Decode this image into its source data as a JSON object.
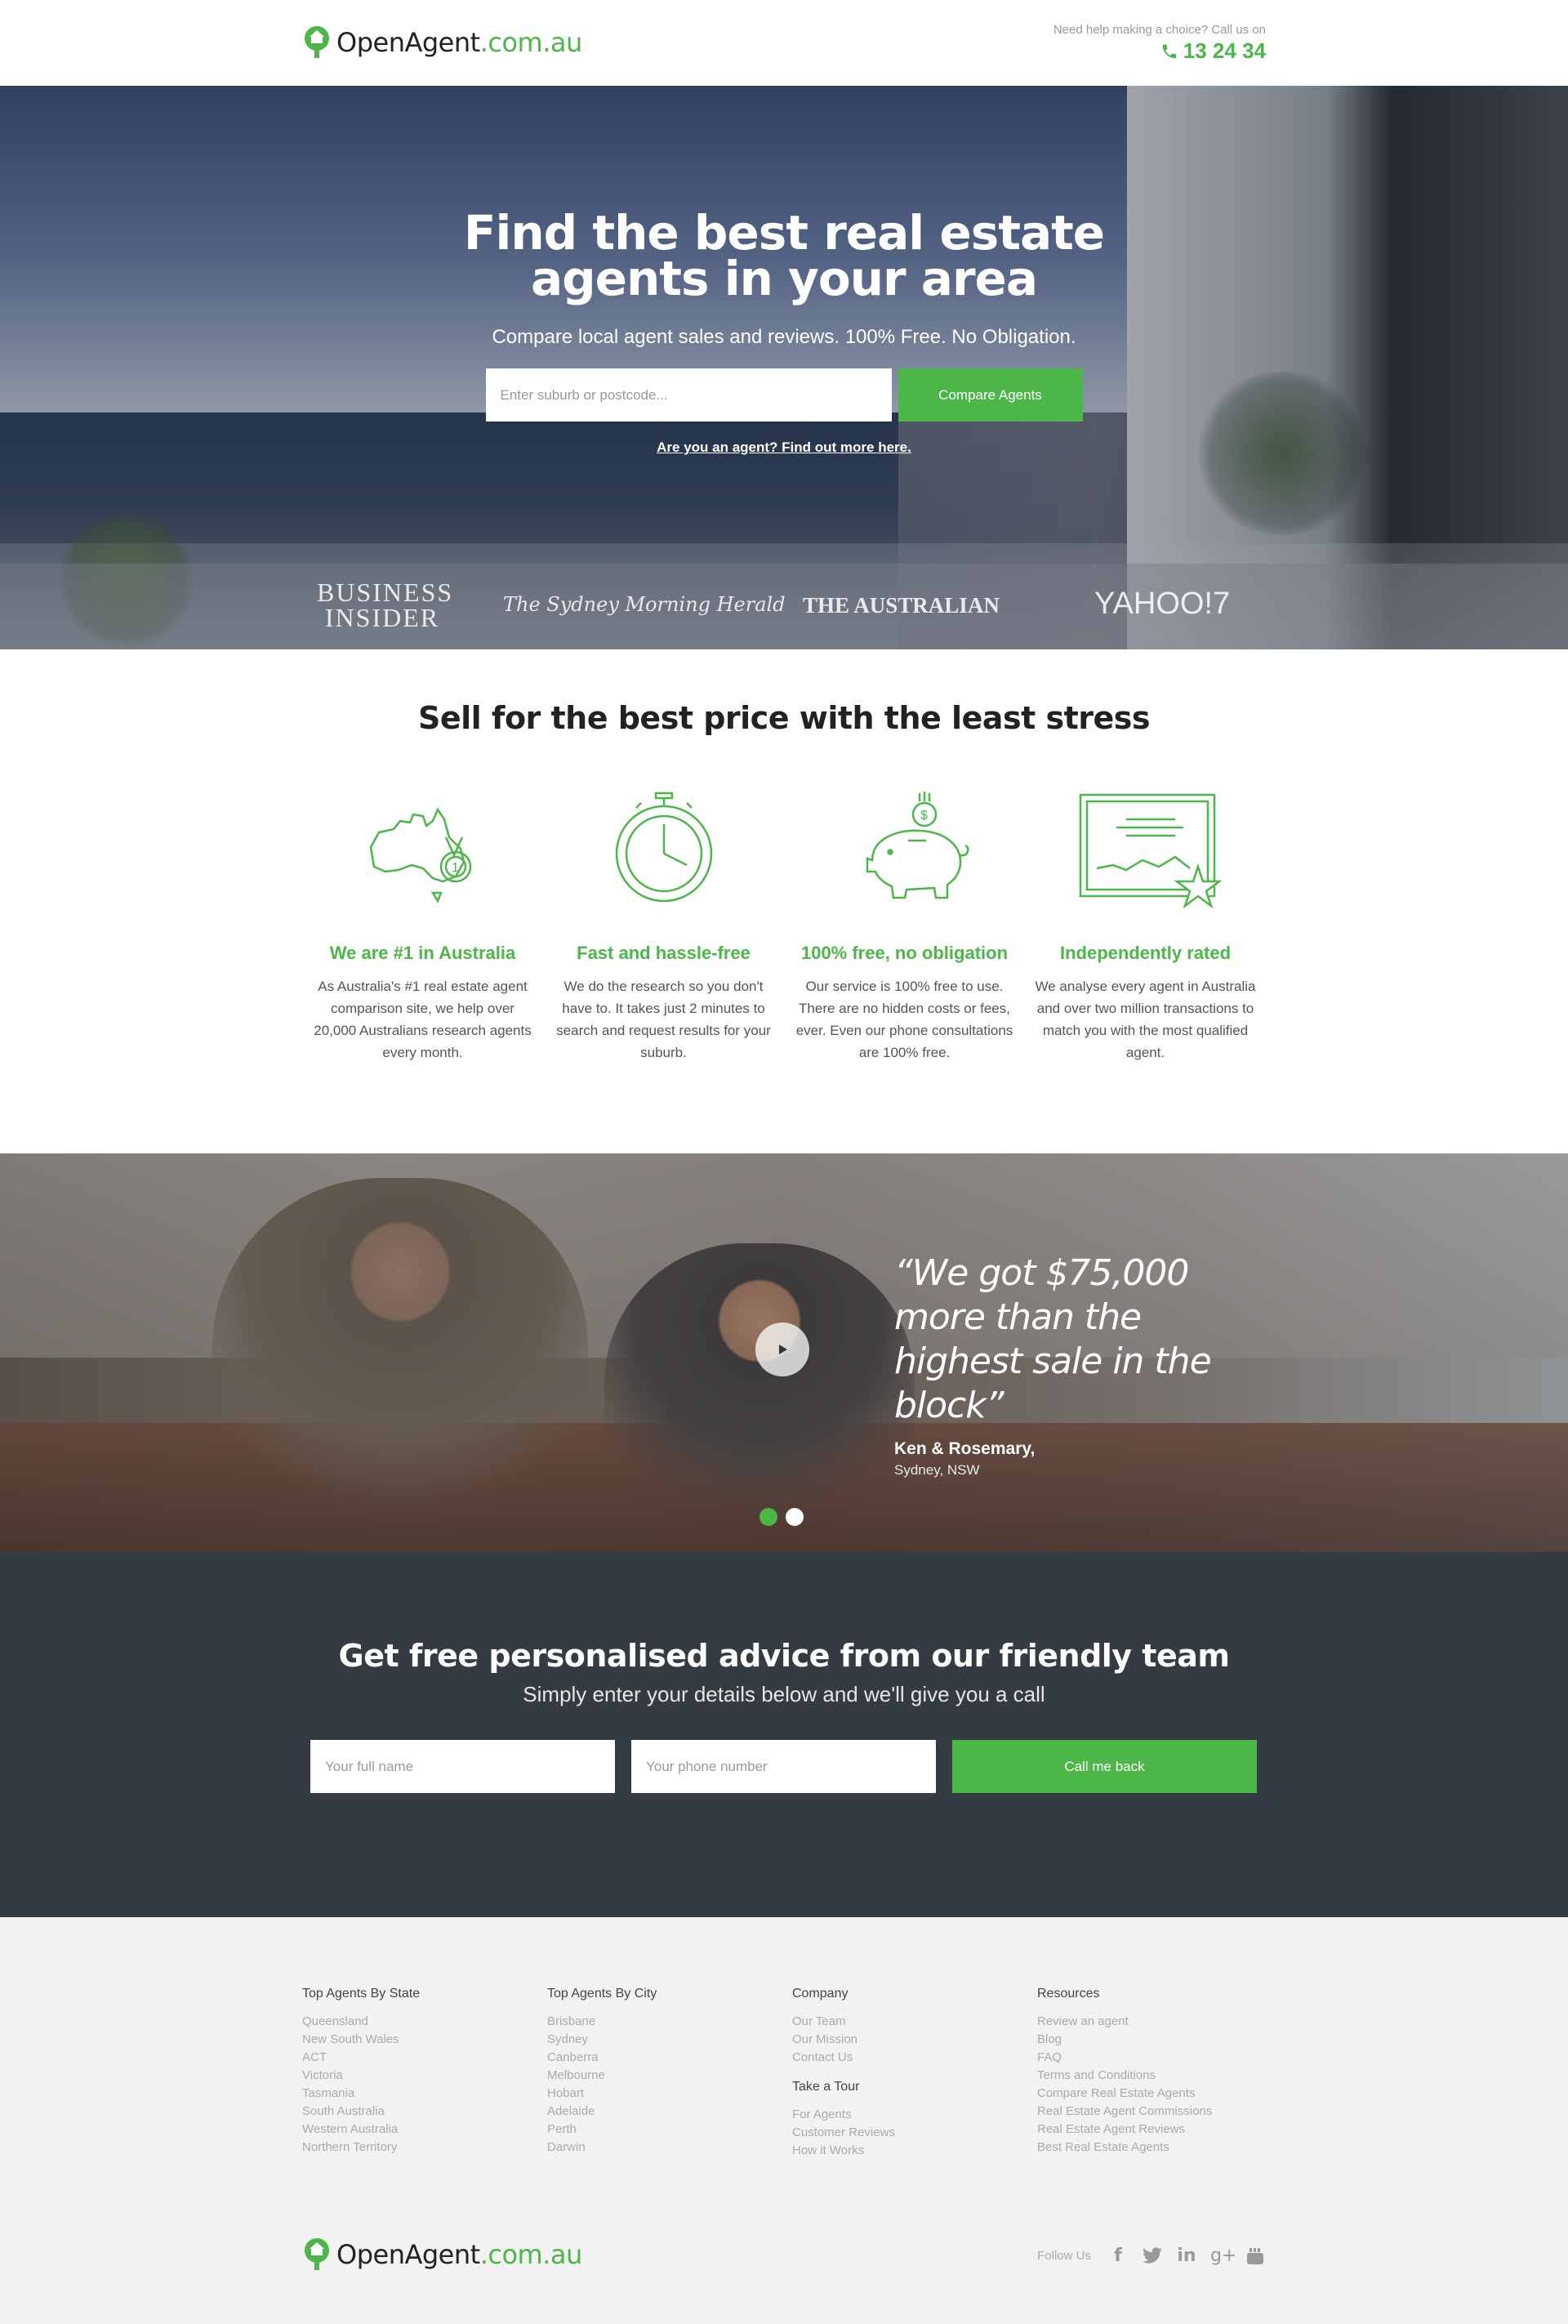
{
  "header": {
    "logo_part1": "OpenAgent",
    "logo_part2": ".com.au",
    "help_text": "Need help making a choice? Call us on",
    "phone": "13 24 34"
  },
  "hero": {
    "title": "Find the best real estate agents in your area",
    "subtitle": "Compare local agent sales and reviews. 100% Free. No Obligation.",
    "search_placeholder": "Enter suburb or postcode...",
    "compare_button": "Compare Agents",
    "agent_link": "Are you an agent? Find out more here.",
    "press": [
      "BUSINESS INSIDER",
      "The Sydney Morning Herald",
      "THE AUSTRALIAN",
      "YAHOO!7"
    ]
  },
  "features": {
    "title": "Sell for the best price with the least stress",
    "items": [
      {
        "icon": "australia-medal-icon",
        "title": "We are #1 in Australia",
        "text": "As Australia's #1 real estate agent comparison site, we help over 20,000 Australians research agents every month."
      },
      {
        "icon": "stopwatch-icon",
        "title": "Fast and hassle-free",
        "text": "We do the research so you don't have to. It takes just 2 minutes to search and request results for your suburb."
      },
      {
        "icon": "piggy-bank-icon",
        "title": "100% free, no obligation",
        "text": "Our service is 100% free to use. There are no hidden costs or fees, ever. Even our phone consultations are 100% free."
      },
      {
        "icon": "rated-chart-icon",
        "title": "Independently rated",
        "text": "We analyse every agent in Australia and over two million transactions to match you with the most qualified agent."
      }
    ]
  },
  "testimonial": {
    "quote": "“We got $75,000 more than the highest sale in the block”",
    "name": "Ken & Rosemary,",
    "location": "Sydney, NSW",
    "active_slide": 1,
    "slide_count": 2
  },
  "cta": {
    "title": "Get free personalised advice from our friendly team",
    "subtitle": "Simply enter your details below and we'll give you a call",
    "name_placeholder": "Your full name",
    "phone_placeholder": "Your phone number",
    "button": "Call me back"
  },
  "footer": {
    "columns": [
      {
        "heading": "Top Agents By State",
        "links": [
          "Queensland",
          "New South Wales",
          "ACT",
          "Victoria",
          "Tasmania",
          "South Australia",
          "Western Australia",
          "Northern Territory"
        ]
      },
      {
        "heading": "Top Agents By City",
        "links": [
          "Brisbane",
          "Sydney",
          "Canberra",
          "Melbourne",
          "Hobart",
          "Adelaide",
          "Perth",
          "Darwin"
        ]
      },
      {
        "heading": "Company",
        "links": [
          "Our Team",
          "Our Mission",
          "Contact Us"
        ],
        "subheading": "Take a Tour",
        "sublinks": [
          "For Agents",
          "Customer Reviews",
          "How it Works"
        ]
      },
      {
        "heading": "Resources",
        "links": [
          "Review an agent",
          "Blog",
          "FAQ",
          "Terms and Conditions",
          "Compare Real Estate Agents",
          "Real Estate Agent Commissions",
          "Real Estate Agent Reviews",
          "Best Real Estate Agents"
        ]
      }
    ],
    "follow_label": "Follow Us",
    "social": [
      "f",
      "t",
      "in",
      "g+",
      "yt"
    ]
  },
  "colors": {
    "brand_green": "#4cb748",
    "dark_band": "#353b43"
  }
}
